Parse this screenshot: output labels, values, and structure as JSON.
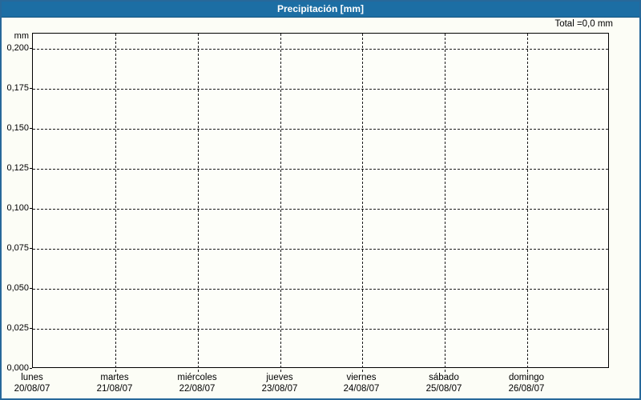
{
  "window": {
    "title": "Precipitación [mm]"
  },
  "summary": {
    "total_label": "Total =0,0 mm"
  },
  "axes": {
    "y_unit": "mm",
    "y_ticks": [
      "0,200",
      "0,175",
      "0,150",
      "0,125",
      "0,100",
      "0,075",
      "0,050",
      "0,025",
      "0,000"
    ],
    "x_ticks": [
      {
        "name": "lunes",
        "date": "20/08/07"
      },
      {
        "name": "martes",
        "date": "21/08/07"
      },
      {
        "name": "miércoles",
        "date": "22/08/07"
      },
      {
        "name": "jueves",
        "date": "23/08/07"
      },
      {
        "name": "viernes",
        "date": "24/08/07"
      },
      {
        "name": "sábado",
        "date": "25/08/07"
      },
      {
        "name": "domingo",
        "date": "26/08/07"
      }
    ]
  },
  "colors": {
    "titlebar": "#1C6EA4",
    "window_border": "#27689A",
    "background": "#FCFDF6",
    "grid": "#1A1A1A",
    "text": "#000000",
    "title_text": "#FFFFFF"
  },
  "chart_data": {
    "type": "bar",
    "title": "Precipitación [mm]",
    "xlabel": "",
    "ylabel": "mm",
    "categories": [
      "lunes 20/08/07",
      "martes 21/08/07",
      "miércoles 22/08/07",
      "jueves 23/08/07",
      "viernes 24/08/07",
      "sábado 25/08/07",
      "domingo 26/08/07"
    ],
    "values": [
      0,
      0,
      0,
      0,
      0,
      0,
      0
    ],
    "total": "0,0 mm",
    "ylim": [
      0,
      0.21
    ],
    "y_tick_step": 0.025,
    "y_tick_values": [
      0.2,
      0.175,
      0.15,
      0.125,
      0.1,
      0.075,
      0.05,
      0.025,
      0.0
    ],
    "decimal_separator": ",",
    "grid": true,
    "grid_style": "dashed",
    "legend": false
  }
}
